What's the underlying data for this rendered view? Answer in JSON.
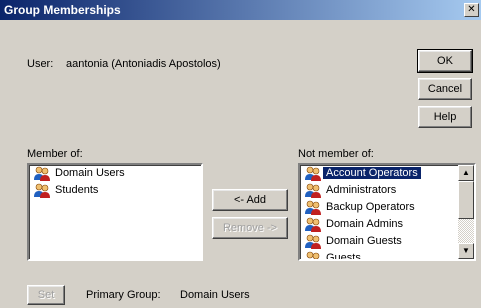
{
  "window": {
    "title": "Group Memberships",
    "close_glyph": "✕"
  },
  "user": {
    "label": "User:",
    "value": "aantonia (Antoniadis Apostolos)"
  },
  "buttons": {
    "ok": "OK",
    "cancel": "Cancel",
    "help": "Help",
    "add": "<- Add",
    "remove": "Remove ->",
    "set": "Set"
  },
  "member_of": {
    "label": "Member of:",
    "items": [
      "Domain Users",
      "Students"
    ]
  },
  "not_member_of": {
    "label": "Not member of:",
    "items": [
      "Account Operators",
      "Administrators",
      "Backup Operators",
      "Domain Admins",
      "Domain Guests",
      "Guests"
    ],
    "selected_index": 0
  },
  "primary_group": {
    "label": "Primary Group:",
    "value": "Domain Users"
  },
  "icons": {
    "group": "group-icon",
    "scroll_up": "scroll-up-arrow-icon",
    "scroll_down": "scroll-down-arrow-icon"
  }
}
